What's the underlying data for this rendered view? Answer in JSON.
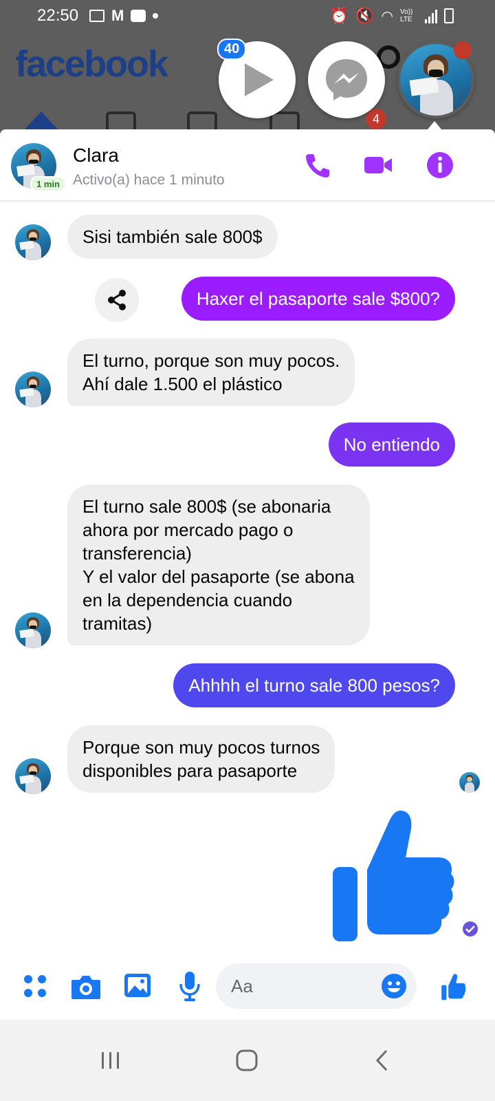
{
  "status_bar": {
    "time": "22:50",
    "lte": "Vo)) LTE"
  },
  "facebook": {
    "logo": "facebook"
  },
  "chat_heads": {
    "video_badge": "40",
    "notif_count": "4"
  },
  "conversation": {
    "contact_name": "Clara",
    "active_status": "Activo(a) hace 1 minuto",
    "active_badge": "1 min",
    "accent_color": "#a033ff"
  },
  "messages": [
    {
      "from": "them",
      "text": "Sisi también sale 800$"
    },
    {
      "from": "me",
      "text": "Haxer el pasaporte sale $800?"
    },
    {
      "from": "them",
      "text": "El turno, porque son muy pocos.\nAhí dale 1.500 el plástico"
    },
    {
      "from": "me",
      "text": "No entiendo"
    },
    {
      "from": "them",
      "text": "El turno sale 800$ (se abonaria\nahora por mercado pago o\ntransferencia)\nY el valor del pasaporte (se abona\nen la dependencia cuando\ntramitas)"
    },
    {
      "from": "me",
      "text": "Ahhhh el turno sale 800 pesos?"
    },
    {
      "from": "them",
      "text": "Porque son muy pocos turnos\ndisponibles para pasaporte"
    }
  ],
  "composer": {
    "placeholder": "Aa",
    "icon_color": "#1877f2"
  }
}
